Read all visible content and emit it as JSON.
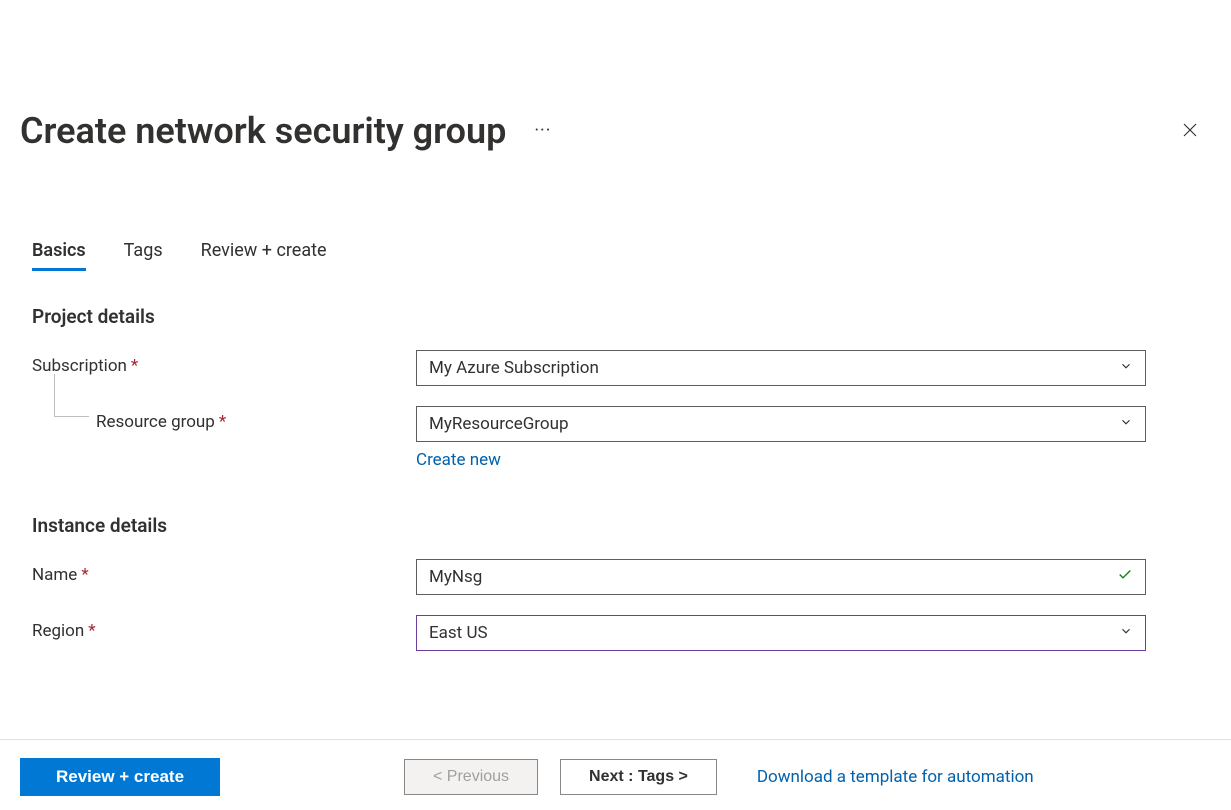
{
  "header": {
    "title": "Create network security group"
  },
  "tabs": {
    "basics": "Basics",
    "tags": "Tags",
    "review": "Review + create"
  },
  "sections": {
    "project_details": "Project details",
    "instance_details": "Instance details"
  },
  "fields": {
    "subscription": {
      "label": "Subscription",
      "value": "My Azure Subscription"
    },
    "resource_group": {
      "label": "Resource group",
      "value": "MyResourceGroup",
      "create_new": "Create new"
    },
    "name": {
      "label": "Name",
      "value": "MyNsg"
    },
    "region": {
      "label": "Region",
      "value": "East US"
    }
  },
  "footer": {
    "review_create": "Review + create",
    "previous": "< Previous",
    "next": "Next : Tags >",
    "download_template": "Download a template for automation"
  }
}
